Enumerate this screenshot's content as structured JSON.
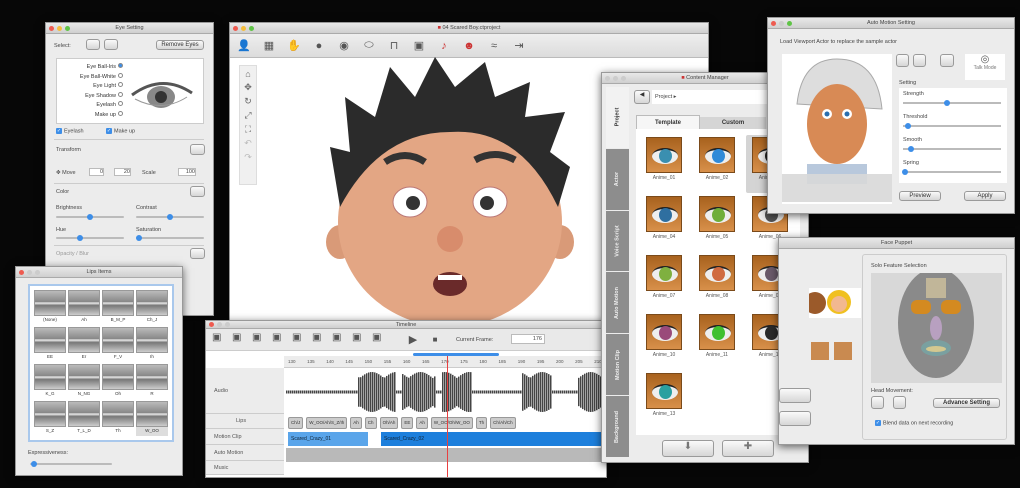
{
  "colors": {
    "accent": "#3d8ee8",
    "close": "#ee5b50",
    "min": "#f5bd3b",
    "max": "#5fc446",
    "skin": "#e3a684",
    "hair": "#2b2b2b",
    "playhead": "#e84040"
  },
  "eye_setting": {
    "title": "Eye Setting",
    "select_label": "Select:",
    "remove_button": "Remove Eyes",
    "parts": [
      "Eye Ball-Iris",
      "Eye Ball-White",
      "Eye Light",
      "Eye Shadow",
      "Eyelash",
      "Make up"
    ],
    "eyelash_check": "Eyelash",
    "makeup_check": "Make up",
    "transform_label": "Transform",
    "move_label": "Move",
    "move_x": "0",
    "move_y": "20",
    "scale_label": "Scale",
    "scale_value": "100",
    "color_label": "Color",
    "brightness": "Brightness",
    "contrast": "Contrast",
    "hue": "Hue",
    "saturation": "Saturation",
    "brightness_val": 0.5,
    "contrast_val": 0.5,
    "hue_val": 0.35,
    "saturation_val": 0.05,
    "opacity_label": "Opacity / Blur"
  },
  "lips": {
    "title": "Lips Items",
    "items": [
      "(None)",
      "Ah",
      "B_M_P",
      "Ch_J",
      "EE",
      "Er",
      "F_V",
      "Ih",
      "K_G",
      "N_NG",
      "Oh",
      "R",
      "S_Z",
      "T_L_D",
      "Th",
      "W_OO"
    ],
    "expressiveness_label": "Expressiveness:",
    "expressiveness_val": 0.05
  },
  "main": {
    "title": "04 Scared Boy.ctproject",
    "toolbar": [
      "actor-icon",
      "motion-icon",
      "hand-icon",
      "head-icon",
      "eye-icon",
      "mouth-icon",
      "neck-icon",
      "image-icon",
      "audio-record-icon",
      "face-record-icon",
      "curve-icon",
      "export-icon"
    ],
    "side_tools": [
      "home-icon",
      "move-icon",
      "rotate-icon",
      "fit-icon",
      "fullscreen-icon",
      "undo-icon",
      "redo-icon"
    ]
  },
  "timeline": {
    "title": "Timeline",
    "current_frame_label": "Current Frame:",
    "current_frame": "176",
    "ruler": [
      "130",
      "135",
      "140",
      "145",
      "150",
      "155",
      "160",
      "165",
      "170",
      "175",
      "180",
      "185",
      "190",
      "195",
      "200",
      "205",
      "210"
    ],
    "tracks": [
      "Audio",
      "Lips",
      "Motion Clip",
      "Auto Motion",
      "Music"
    ],
    "lips_clips": [
      "Ch/J",
      "W_OO/Ah/S_Z/Ih",
      "Ah",
      "Ch",
      "Oh/Ah",
      "EE",
      "Ah",
      "W_OO/Oh/W_OO",
      "Th",
      "Ch/Ah/Ch"
    ],
    "motion_clips": [
      "Scared_Crazy_01",
      "Scared_Crazy_02"
    ]
  },
  "content_manager": {
    "title": "Content Manager",
    "path": "Project ▸",
    "tabs": [
      "Template",
      "Custom"
    ],
    "side_tabs": [
      "Project",
      "Actor",
      "Voice Script",
      "Auto Motion",
      "Motion Clip",
      "Background"
    ],
    "items": [
      {
        "name": "Anime_01",
        "iris": "#3a8fb0"
      },
      {
        "name": "Anime_02",
        "iris": "#2f8ad8"
      },
      {
        "name": "Anime_03",
        "iris": "#222222"
      },
      {
        "name": "Anime_04",
        "iris": "#2f6fa0"
      },
      {
        "name": "Anime_05",
        "iris": "#6fae3a"
      },
      {
        "name": "Anime_06",
        "iris": "#555555"
      },
      {
        "name": "Anime_07",
        "iris": "#7fb040"
      },
      {
        "name": "Anime_08",
        "iris": "#d06a40"
      },
      {
        "name": "Anime_09",
        "iris": "#6a5a6a"
      },
      {
        "name": "Anime_10",
        "iris": "#9a4a7a"
      },
      {
        "name": "Anime_11",
        "iris": "#3fc030"
      },
      {
        "name": "Anime_12",
        "iris": "#2a2a2a"
      },
      {
        "name": "Anime_13",
        "iris": "#2aa0a0"
      }
    ],
    "selected": "Anime_03"
  },
  "auto_motion": {
    "title": "Auto Motion Setting",
    "hint": "Load Viewport Actor to replace the sample actor",
    "talk_mode": "Talk Mode",
    "setting_label": "Setting",
    "sliders": [
      {
        "label": "Strength",
        "value": 0.45
      },
      {
        "label": "Threshold",
        "value": 0.05
      },
      {
        "label": "Smooth",
        "value": 0.08
      },
      {
        "label": "Spring",
        "value": 0.02
      }
    ],
    "preview": "Preview",
    "apply": "Apply"
  },
  "face_puppet": {
    "title": "Face Puppet",
    "solo_label": "Solo Feature Selection",
    "head_movement": "Head Movement:",
    "advance": "Advance Setting",
    "blend": "Blend data on next recording"
  }
}
